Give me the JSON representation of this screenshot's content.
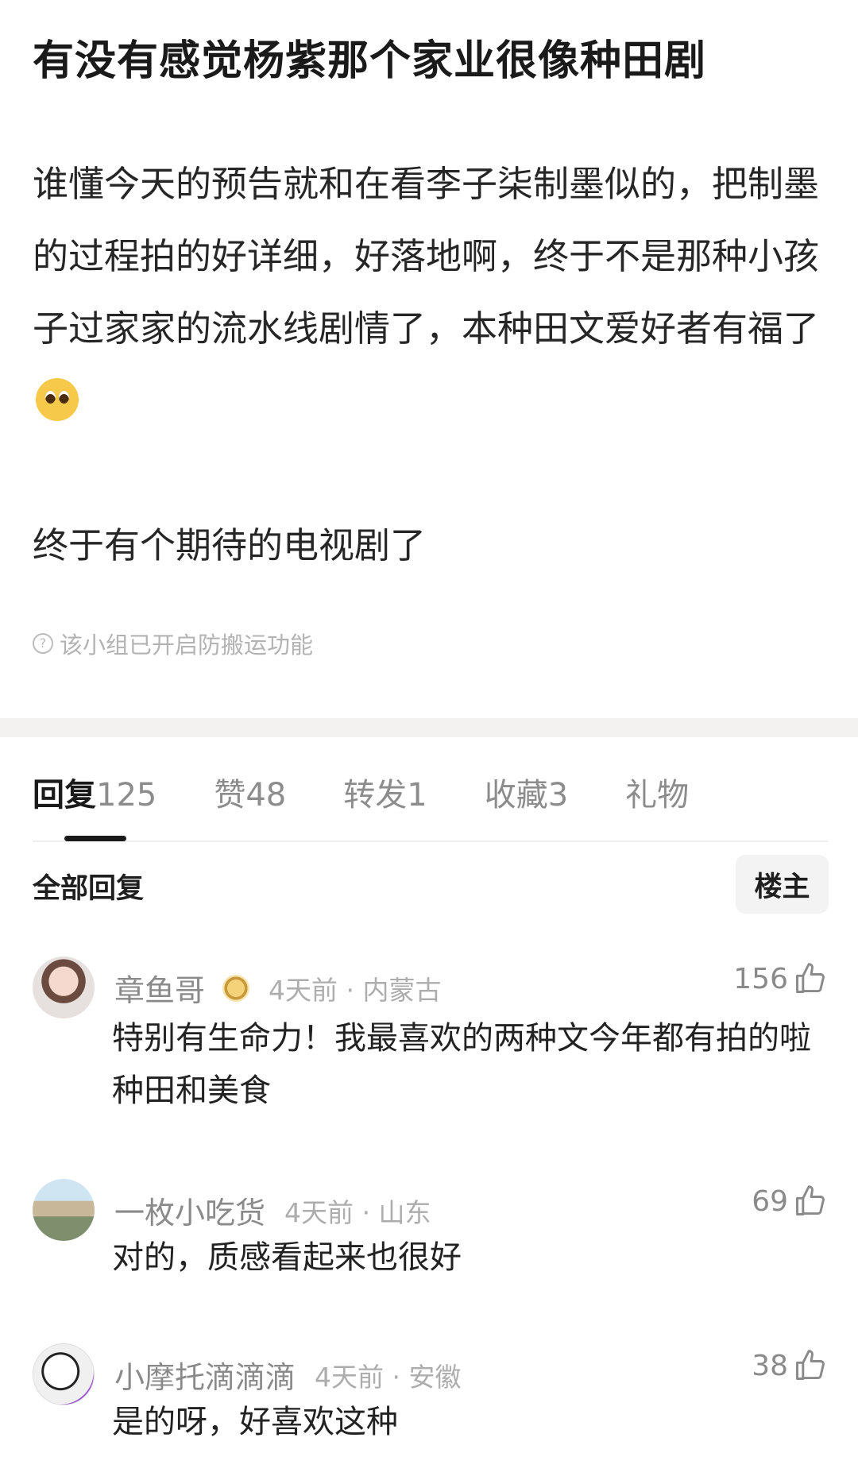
{
  "post": {
    "title": "有没有感觉杨紫那个家业很像种田剧",
    "paragraph1": "谁懂今天的预告就和在看李子柒制墨似的，把制墨的过程拍的好详细，好落地啊，终于不是那种小孩子过家家的流水线剧情了，本种田文爱好者有福了",
    "paragraph1_emoji": "pleading-face-emoji",
    "paragraph2": "终于有个期待的电视剧了",
    "notice": "该小组已开启防搬运功能",
    "notice_icon": "question-circle-icon"
  },
  "tabs": [
    {
      "label": "回复",
      "count": "125",
      "active": true
    },
    {
      "label": "赞",
      "count": "48"
    },
    {
      "label": "转发",
      "count": "1"
    },
    {
      "label": "收藏",
      "count": "3"
    },
    {
      "label": "礼物",
      "count": ""
    }
  ],
  "replies_header": {
    "title": "全部回复",
    "filter_button": "楼主"
  },
  "comments": [
    {
      "name": "章鱼哥",
      "has_badge": true,
      "time": "4天前",
      "location": "内蒙古",
      "likes": "156",
      "text": "特别有生命力！我最喜欢的两种文今年都有拍的啦种田和美食"
    },
    {
      "name": "一枚小吃货",
      "has_badge": false,
      "time": "4天前",
      "location": "山东",
      "likes": "69",
      "text": "对的，质感看起来也很好"
    },
    {
      "name": "小摩托滴滴滴",
      "has_badge": false,
      "time": "4天前",
      "location": "安徽",
      "likes": "38",
      "text": "是的呀，好喜欢这种"
    }
  ],
  "colors": {
    "title": "#1a1a1a",
    "muted": "#8a8a8a",
    "divider_band": "#f3f2f0"
  }
}
